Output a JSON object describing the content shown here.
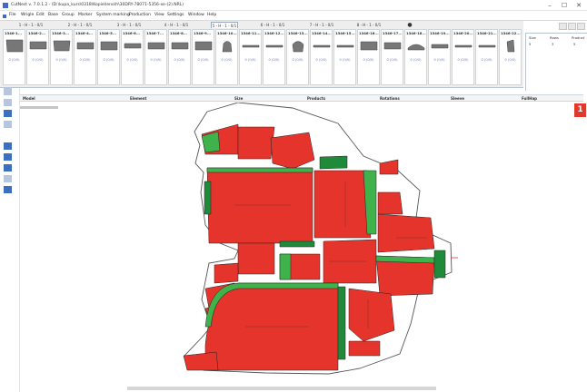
{
  "window": {
    "title": "CutNest v. 7.0.1.2 - (D:\\kupa_kurs\\0318\\Kopie\\leno\\h\\30DRY-78071-5356-xe-(2).NRL)",
    "minimize_glyph": "–",
    "maximize_glyph": "☐",
    "close_glyph": "✕"
  },
  "menu": [
    "File",
    "Wrigle",
    "Edit",
    "Base",
    "Group",
    "Marker",
    "System marking",
    "Production",
    "View",
    "Settings",
    "Window",
    "Help"
  ],
  "groups": [
    {
      "label": "1 - H - 1 - 0/1"
    },
    {
      "label": "2 - H - 1 - 0/1"
    },
    {
      "label": "3 - H - 1 - 0/1"
    },
    {
      "label": "4 - H - 1 - 0/1"
    },
    {
      "label": "5 - H - 1 - 0/1"
    },
    {
      "label": "6 - H - 1 - 0/1"
    },
    {
      "label": "7 - H - 1 - 0/1"
    },
    {
      "label": "8 - H - 1 - 0/1"
    }
  ],
  "pieces": [
    {
      "label": "1346-1...",
      "count": "0 (0/0)"
    },
    {
      "label": "1346-2...",
      "count": "0 (0/0)"
    },
    {
      "label": "1346-3...",
      "count": "0 (0/0)"
    },
    {
      "label": "1346-4...",
      "count": "0 (0/0)"
    },
    {
      "label": "1346-5...",
      "count": "0 (0/0)"
    },
    {
      "label": "1346-6...",
      "count": "0 (0/0)"
    },
    {
      "label": "1346-7...",
      "count": "0 (0/0)"
    },
    {
      "label": "1346-8...",
      "count": "0 (0/0)"
    },
    {
      "label": "1346-9...",
      "count": "0 (0/0)"
    },
    {
      "label": "1346-10...",
      "count": "0 (0/0)"
    },
    {
      "label": "1346-11...",
      "count": "0 (0/0)"
    },
    {
      "label": "1346-12...",
      "count": "0 (0/0)"
    },
    {
      "label": "1346-13...",
      "count": "0 (0/0)"
    },
    {
      "label": "1346-14...",
      "count": "0 (0/0)"
    },
    {
      "label": "1346-15...",
      "count": "0 (0/0)"
    },
    {
      "label": "1346-16...",
      "count": "0 (0/0)"
    },
    {
      "label": "1346-17...",
      "count": "0 (0/0)"
    },
    {
      "label": "1346-18...",
      "count": "0 (0/0)"
    },
    {
      "label": "1346-19...",
      "count": "0 (0/0)"
    },
    {
      "label": "1346-20...",
      "count": "0 (0/0)"
    },
    {
      "label": "1346-21...",
      "count": "0 (0/0)"
    },
    {
      "label": "1346-22...",
      "count": "0 (0/0)"
    }
  ],
  "size_panel": {
    "headers": [
      "Size",
      "Rows",
      "Product"
    ],
    "row": [
      "5",
      "3",
      "5"
    ]
  },
  "columns": [
    "Model",
    "Element",
    "Size",
    "Products",
    "Rotations",
    "Sleeve",
    "FullHap"
  ],
  "badge": "1",
  "colors": {
    "piece_fill": "#e4342b",
    "piece_green": "#1f8a3a",
    "piece_edge_green": "#3fb24b",
    "leather_outline": "#555555",
    "tool_active": "#3c6fbd"
  }
}
